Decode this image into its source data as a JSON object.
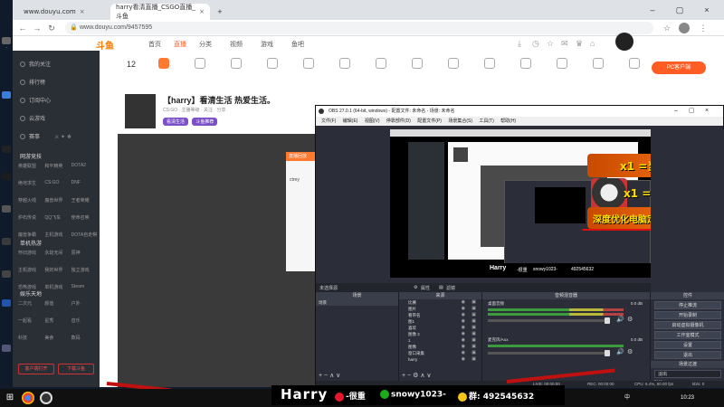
{
  "browser": {
    "tabs": [
      {
        "title": "www.douyu.com",
        "active": false
      },
      {
        "title": "harry看清直播_CSGO直播_斗鱼",
        "active": true
      }
    ],
    "url": "www.douyu.com/9457595"
  },
  "site": {
    "logo": "斗鱼",
    "nav": [
      {
        "label": "首页",
        "active": false
      },
      {
        "label": "直播",
        "active": true
      },
      {
        "label": "分类",
        "active": false
      },
      {
        "label": "视频",
        "active": false
      },
      {
        "label": "游戏",
        "active": false
      },
      {
        "label": "鱼吧",
        "active": false
      }
    ],
    "level_number": "12",
    "pc_button": "PC客户端"
  },
  "sidebar": {
    "items": [
      "我的关注",
      "排行榜",
      "订阅中心",
      "云游戏",
      "赛事"
    ],
    "section_1": "网游竞技",
    "grid_1": [
      "英雄联盟",
      "和平精英",
      "DOTA2",
      "绝地求生",
      "CS:GO",
      "DNF",
      "穿越火线",
      "魔兽世界",
      "王者荣耀",
      "炉石传说",
      "QQ飞车",
      "使命召唤",
      "魔兽争霸",
      "主机游戏",
      "DOTA自走棋"
    ],
    "section_2": "单机热游",
    "grid_2": [
      "怀旧游戏",
      "永劫无间",
      "原神",
      "主机游戏",
      "我的世界",
      "独立游戏",
      "恐怖游戏",
      "单机游戏",
      "Steam"
    ],
    "section_3": "娱乐天地",
    "grid_3": [
      "二次元",
      "颜值",
      "户外",
      "一起看",
      "星秀",
      "音乐",
      "科技",
      "美食",
      "数码"
    ],
    "buttons": [
      "客户端打开",
      "下载斗鱼"
    ]
  },
  "room": {
    "title": "【harry】看清生活 热爱生活。",
    "anchor": "harry看清",
    "meta": "CS:GO · 主播等级 · 关注 · 分享",
    "tags": [
      "看清生活",
      "斗鱼推荐"
    ]
  },
  "popup": {
    "header": "直播回放",
    "body": "ctrey"
  },
  "obs": {
    "title": "OBS 27.0.1 (64-bit, windows) - 配置文件: 未命名 - 场景: 未命名",
    "menu": [
      "文件(F)",
      "编辑(E)",
      "视图(V)",
      "停靠部件(D)",
      "配置文件(P)",
      "场景集合(S)",
      "工具(T)",
      "帮助(H)"
    ],
    "scene_tabs_label": "未选择源",
    "props_button": "属性",
    "filters_button": "滤镜",
    "docks": {
      "scenes": "场景",
      "sources": "来源",
      "mixer": "音频混音器",
      "controls": "控件"
    },
    "scene_items": [
      "场景"
    ],
    "sources": [
      "比赛",
      "图片",
      "看带名",
      "图1",
      "喜欢",
      "图像 2",
      "1",
      "图像",
      "窗口采集",
      "harry"
    ],
    "mixer_tracks": [
      {
        "name": "桌面音频",
        "db": "0.0 dB"
      },
      {
        "name": "麦克风/Aux",
        "db": "0.0 dB"
      }
    ],
    "controls": [
      "停止推流",
      "开始录制",
      "启动虚拟摄像机",
      "工作室模式",
      "设置",
      "退出"
    ],
    "transition_title": "场景过渡",
    "transition": "淡出",
    "duration_label": "时长",
    "duration": "300 ms",
    "status": {
      "live": "LIVE: 00:00:00",
      "rec": "REC: 00:00:00",
      "cpu": "CPU: 6.4%, 60.00 fps",
      "kbps": "kb/s: 0"
    }
  },
  "overlay": {
    "line1": "x1 =当天车位",
    "line2": "x1 =房管+",
    "line2b": "群",
    "line3": "深度优化电脑定级上分+",
    "preview_name": "Harry",
    "preview_weibo": "-很重",
    "preview_wechat": "snowy1023-",
    "preview_qq": "492545632"
  },
  "banner": {
    "name": "Harry",
    "weibo": "-很重",
    "wechat": "snowy1023-",
    "group_label": "群:",
    "group": "492545632"
  },
  "taskbar": {
    "time": "10:23",
    "date": "",
    "lang": "中"
  },
  "colors": {
    "accent": "#ff5d23",
    "obs_bg": "#2b2e38",
    "overlay_yellow": "#ffe000",
    "stripe_red": "#c01010"
  }
}
